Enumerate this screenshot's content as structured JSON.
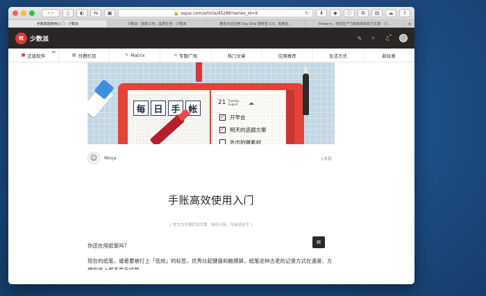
{
  "browser": {
    "url": "sspai.com/article/45288?series_id=9",
    "tabs": [
      "手账高效使用入门 - 少数派",
      "少数派 - 高效工作，品质生活 - 少数派",
      "着名日记应用 Day One 更新至 3.0，看续支…",
      "Power+，你的生产力和效率的有力文章 - 少…"
    ],
    "tab_add": "+"
  },
  "site": {
    "logo_glyph": "π",
    "logo_text": "少数派",
    "nav": [
      {
        "icon": "■",
        "label": "正版软件"
      },
      {
        "icon": "▤",
        "label": "付费栏目"
      },
      {
        "icon": "✎",
        "label": "Matrix"
      },
      {
        "icon": "⌂",
        "label": "专题广场"
      },
      {
        "icon": "",
        "label": "热门文章"
      },
      {
        "icon": "",
        "label": "应用推荐"
      },
      {
        "icon": "",
        "label": "生活方式"
      },
      {
        "icon": "",
        "label": "新玩意"
      }
    ]
  },
  "hero": {
    "stamps": [
      "每",
      "日",
      "手",
      "帐"
    ],
    "date_num": "21",
    "date_day": "Tuesday",
    "date_month": "August",
    "todos": [
      {
        "checked": true,
        "text": "开早会"
      },
      {
        "checked": true,
        "text": "明天的选题方案"
      },
      {
        "checked": false,
        "text": "外出拍摄素材"
      }
    ]
  },
  "article": {
    "author": "Minja",
    "time": "1天前",
    "title": "手账高效使用入门",
    "note": "[ 本文为付费栏目文章，信任订阅，可阅读全文 ]",
    "para1": "你还在用纸笔吗？",
    "para2": "现在的纸笔，或者要被打上「低效」的标签，优秀比起键盘和触摸屏，纸笔这种古老的记录方式在速度、方便程度上都不再有优势。"
  },
  "colors": {
    "brand_red": "#d83b36",
    "header_dark": "#2b2626"
  }
}
